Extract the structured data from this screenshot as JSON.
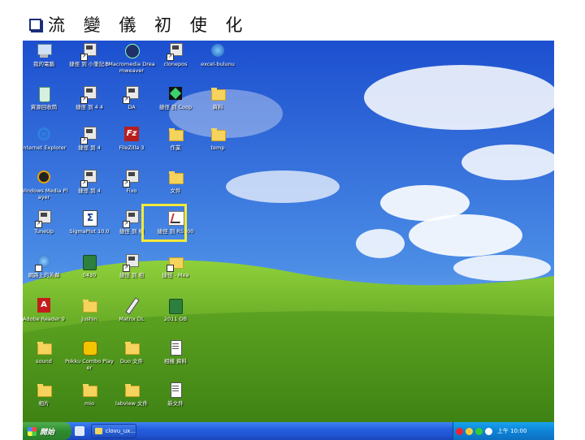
{
  "slide": {
    "title": "流 變 儀 初 使 化"
  },
  "desktop": {
    "icons": [
      {
        "label": "我的電腦",
        "type": "computer"
      },
      {
        "label": "捷徑 到 小筆記本",
        "type": "shortcut"
      },
      {
        "label": "Macromedia Dreamweaver",
        "type": "app-dark"
      },
      {
        "label": "clonepos",
        "type": "shortcut"
      },
      {
        "label": "excel-bulunu",
        "type": "globe"
      },
      {
        "label": "資源回收筒",
        "type": "recycle"
      },
      {
        "label": "捷徑 到 4 4",
        "type": "shortcut"
      },
      {
        "label": "DA",
        "type": "shortcut"
      },
      {
        "label": "捷徑 到 Coop",
        "type": "xbox"
      },
      {
        "label": "資料",
        "type": "folder"
      },
      {
        "label": "Internet Explorer",
        "type": "ie"
      },
      {
        "label": "捷徑 到 4",
        "type": "shortcut"
      },
      {
        "label": "FileZilla 3",
        "type": "filezilla"
      },
      {
        "label": "作業",
        "type": "folder"
      },
      {
        "label": "temp",
        "type": "folder"
      },
      {
        "label": "Windows Media Player",
        "type": "media"
      },
      {
        "label": "捷徑 到 4",
        "type": "shortcut"
      },
      {
        "label": "Fixo",
        "type": "shortcut"
      },
      {
        "label": "文件",
        "type": "folder"
      },
      {
        "label": "TuneUp",
        "type": "shortcut"
      },
      {
        "label": "SigmaPlot 10.0",
        "type": "sigma"
      },
      {
        "label": "捷徑 到 相",
        "type": "shortcut"
      },
      {
        "label": "捷徑 到 RS300",
        "type": "rheo"
      },
      {
        "label": "網路上的芳鄰",
        "type": "network"
      },
      {
        "label": "0430",
        "type": "book"
      },
      {
        "label": "捷徑 到 相",
        "type": "shortcut"
      },
      {
        "label": "捷徑 - Mea",
        "type": "folder-shortcut"
      },
      {
        "label": "Adobe Reader 9",
        "type": "adobe"
      },
      {
        "label": "Jushin",
        "type": "folder"
      },
      {
        "label": "Matrix DL",
        "type": "pen"
      },
      {
        "label": "2011 OB",
        "type": "book"
      },
      {
        "label": "sound",
        "type": "folder"
      },
      {
        "label": "Pokku Combo Player",
        "type": "pokku"
      },
      {
        "label": "Duo 文件",
        "type": "folder"
      },
      {
        "label": "相機 資料",
        "type": "doc"
      },
      {
        "label": "相片",
        "type": "folder"
      },
      {
        "label": "mio",
        "type": "folder"
      },
      {
        "label": "labview 文件",
        "type": "folder"
      },
      {
        "label": "新文件",
        "type": "doc"
      }
    ]
  },
  "taskbar": {
    "start_label": "開始",
    "window_label": "clovu_ux...",
    "clock": "上午 10:00"
  },
  "colors": {
    "sky_top": "#1c5ad6",
    "sky_bottom": "#9ec3ef",
    "hill_light": "#7ec02f",
    "hill_dark": "#3a7f12",
    "highlight": "#f3ea3a"
  }
}
